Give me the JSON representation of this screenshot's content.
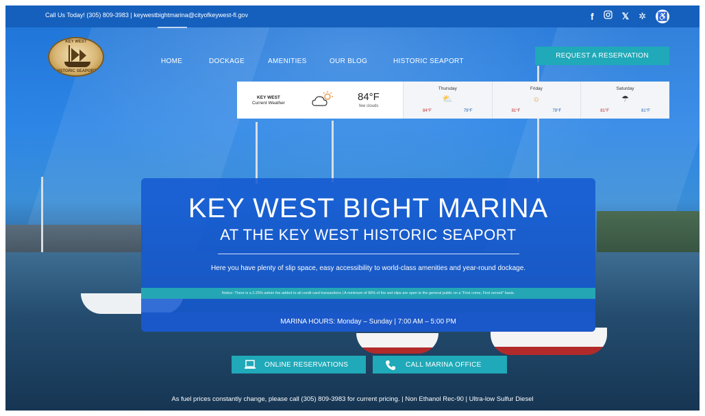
{
  "topbar": {
    "contact": "Call Us Today! (305) 809-3983  |  keywestbightmarina@cityofkeywest-fl.gov",
    "social_icons": [
      "facebook-icon",
      "instagram-icon",
      "x-icon",
      "yelp-icon",
      "accessibility-icon"
    ]
  },
  "logo": {
    "line1": "KEY WEST",
    "line2": "HISTORIC SEAPORT"
  },
  "nav": {
    "items": [
      "HOME",
      "DOCKAGE",
      "AMENITIES",
      "OUR BLOG",
      "HISTORIC SEAPORT"
    ],
    "cta": "REQUEST A RESERVATION"
  },
  "weather": {
    "location": "KEY WEST",
    "location_sub": "Current Weather",
    "temp": "84°F",
    "desc": "few clouds",
    "days": [
      {
        "name": "Thursday",
        "icon": "partly-cloudy-icon",
        "hi": "84°F",
        "lo": "79°F"
      },
      {
        "name": "Friday",
        "icon": "sun-icon",
        "hi": "81°F",
        "lo": "79°F"
      },
      {
        "name": "Saturday",
        "icon": "rain-cloud-icon",
        "hi": "81°F",
        "lo": "81°F"
      }
    ]
  },
  "hero": {
    "title": "KEY WEST BIGHT MARINA",
    "subtitle": "AT THE KEY WEST HISTORIC SEAPORT",
    "description": "Here you have plenty of slip space, easy accessibility to world-class amenities and year-round dockage.",
    "notice": "Notice: There is a 2.25% admin fee added to all credit card transactions  |  A minimum of 90% of the wet slips are open to the general public on a \"First come, First served\" basis.",
    "hours": "MARINA HOURS:  Monday – Sunday | 7:00 AM – 5:00 PM"
  },
  "buttons": {
    "online": "ONLINE RESERVATIONS",
    "call": "CALL MARINA OFFICE"
  },
  "footer": {
    "fuel": "As fuel prices constantly change, please call (305) 809-3983 for current pricing.  |  Non Ethanol Rec-90  |  Ultra-low Sulfur Diesel"
  },
  "colors": {
    "primary_blue": "#1560bd",
    "teal": "#20a9b8",
    "hero_blue": "#1458d2"
  }
}
